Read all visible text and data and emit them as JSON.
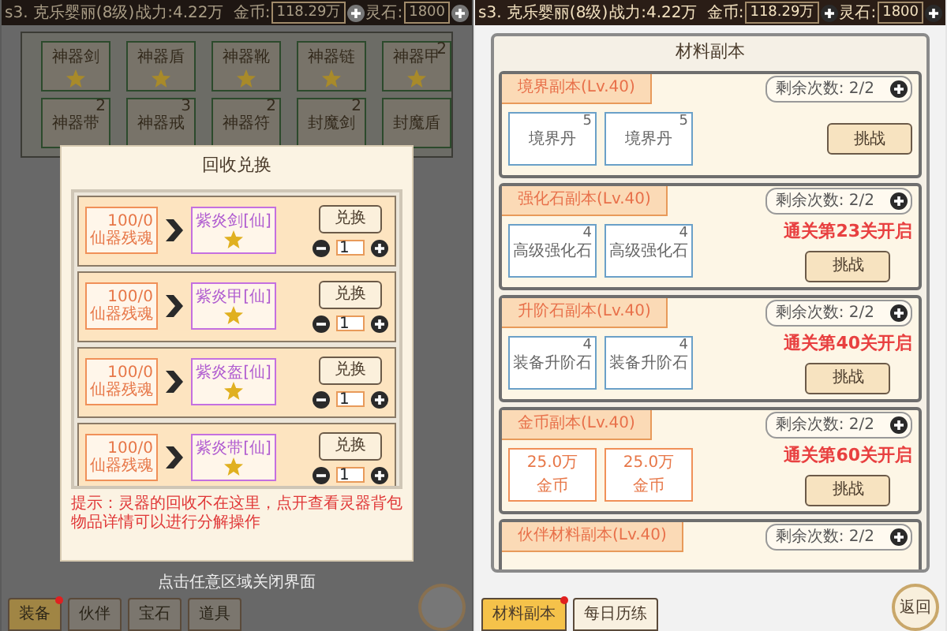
{
  "left_screen": {
    "top_bar": {
      "player": "s3. 克乐婴丽(8级)",
      "power": "战力:4.22万",
      "gold_label": "金币:",
      "gold": "118.29万",
      "stone_label": "灵石:",
      "stone": "1800"
    },
    "inventory": [
      {
        "name": "神器剑",
        "starred": true
      },
      {
        "name": "神器盾",
        "starred": true
      },
      {
        "name": "神器靴",
        "starred": true
      },
      {
        "name": "神器链",
        "starred": true
      },
      {
        "name": "神器甲",
        "count": "2",
        "starred": true
      },
      {
        "name": "神器带",
        "count": "2",
        "starred": false
      },
      {
        "name": "神器戒",
        "count": "3",
        "starred": false
      },
      {
        "name": "神器符",
        "count": "2",
        "starred": false
      },
      {
        "name": "封魔剑",
        "count": "2",
        "starred": false
      },
      {
        "name": "封魔盾",
        "starred": false
      }
    ],
    "dialog": {
      "title": "回收兑换",
      "rows": [
        {
          "cost_count": "100/0",
          "cost_name": "仙器残魂",
          "reward": "紫炎剑[仙]",
          "button": "兑换",
          "quantity": "1"
        },
        {
          "cost_count": "100/0",
          "cost_name": "仙器残魂",
          "reward": "紫炎甲[仙]",
          "button": "兑换",
          "quantity": "1"
        },
        {
          "cost_count": "100/0",
          "cost_name": "仙器残魂",
          "reward": "紫炎盔[仙]",
          "button": "兑换",
          "quantity": "1"
        },
        {
          "cost_count": "100/0",
          "cost_name": "仙器残魂",
          "reward": "紫炎带[仙]",
          "button": "兑换",
          "quantity": "1"
        }
      ],
      "tip": "提示：灵器的回收不在这里，点开查看灵器背包物品详情可以进行分解操作"
    },
    "close_hint": "点击任意区域关闭界面",
    "tabs": [
      {
        "label": "装备",
        "selected": true,
        "alert": true
      },
      {
        "label": "伙伴",
        "selected": false,
        "alert": false
      },
      {
        "label": "宝石",
        "selected": false,
        "alert": false
      },
      {
        "label": "道具",
        "selected": false,
        "alert": false
      }
    ]
  },
  "right_screen": {
    "top_bar": {
      "player": "s3. 克乐婴丽(8级)",
      "power": "战力:4.22万",
      "gold_label": "金币:",
      "gold": "118.29万",
      "stone_label": "灵石:",
      "stone": "1800"
    },
    "title": "材料副本",
    "sections": [
      {
        "title": "境界副本(Lv.40)",
        "remaining": "剩余次数: 2/2",
        "items": [
          {
            "kind": "material",
            "name": "境界丹",
            "count": "5"
          },
          {
            "kind": "material",
            "name": "境界丹",
            "count": "5"
          }
        ],
        "button": "挑战"
      },
      {
        "title": "强化石副本(Lv.40)",
        "remaining": "剩余次数: 2/2",
        "items": [
          {
            "kind": "material",
            "name": "高级强化石",
            "count": "4"
          },
          {
            "kind": "material",
            "name": "高级强化石",
            "count": "4"
          }
        ],
        "unlock": "通关第23关开启",
        "button": "挑战"
      },
      {
        "title": "升阶石副本(Lv.40)",
        "remaining": "剩余次数: 2/2",
        "items": [
          {
            "kind": "material",
            "name": "装备升阶石",
            "count": "4"
          },
          {
            "kind": "material",
            "name": "装备升阶石",
            "count": "4"
          }
        ],
        "unlock": "通关第40关开启",
        "button": "挑战"
      },
      {
        "title": "金币副本(Lv.40)",
        "remaining": "剩余次数: 2/2",
        "items": [
          {
            "kind": "coin",
            "name": "金币",
            "count": "25.0万"
          },
          {
            "kind": "coin",
            "name": "金币",
            "count": "25.0万"
          }
        ],
        "unlock": "通关第60关开启",
        "button": "挑战"
      },
      {
        "title": "伙伴材料副本(Lv.40)",
        "remaining": "剩余次数: 2/2"
      }
    ],
    "tabs": [
      {
        "label": "材料副本",
        "selected": true,
        "alert": true
      },
      {
        "label": "每日历练",
        "selected": false,
        "alert": false
      }
    ],
    "back_button": "返回"
  }
}
